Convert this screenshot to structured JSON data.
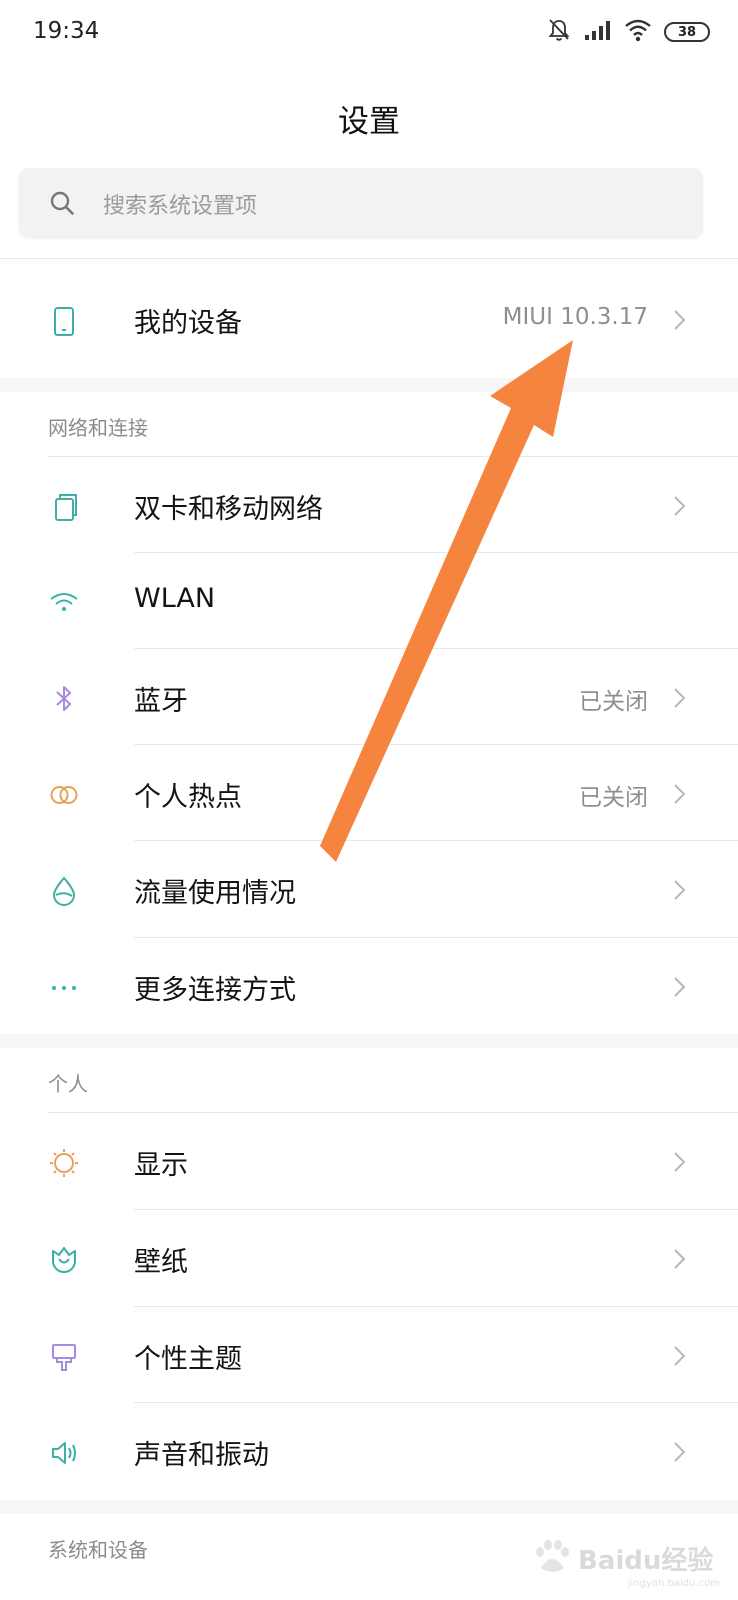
{
  "status_bar": {
    "time": "19:34",
    "battery": "38",
    "icons": [
      "bell-mute-icon",
      "signal-icon",
      "wifi-icon",
      "battery-icon"
    ]
  },
  "page": {
    "title": "设置"
  },
  "search": {
    "placeholder": "搜索系统设置项",
    "icon": "search-icon"
  },
  "my_device": {
    "label": "我的设备",
    "value": "MIUI 10.3.17",
    "icon": "phone-icon"
  },
  "sections": {
    "network": {
      "header": "网络和连接",
      "items": [
        {
          "label": "双卡和移动网络",
          "value": "",
          "icon": "dual-sim-icon"
        },
        {
          "label": "WLAN",
          "value": "",
          "icon": "wifi-icon"
        },
        {
          "label": "蓝牙",
          "value": "已关闭",
          "icon": "bluetooth-icon"
        },
        {
          "label": "个人热点",
          "value": "已关闭",
          "icon": "hotspot-icon"
        },
        {
          "label": "流量使用情况",
          "value": "",
          "icon": "data-usage-icon"
        },
        {
          "label": "更多连接方式",
          "value": "",
          "icon": "more-icon"
        }
      ]
    },
    "personal": {
      "header": "个人",
      "items": [
        {
          "label": "显示",
          "value": "",
          "icon": "sun-icon"
        },
        {
          "label": "壁纸",
          "value": "",
          "icon": "tulip-icon"
        },
        {
          "label": "个性主题",
          "value": "",
          "icon": "brush-icon"
        },
        {
          "label": "声音和振动",
          "value": "",
          "icon": "speaker-icon"
        }
      ]
    },
    "system": {
      "header": "系统和设备"
    }
  },
  "annotation": {
    "arrow_color": "#f47a2f"
  },
  "watermark": {
    "text": "Baidu经验",
    "sub": "jingyan.baidu.com"
  },
  "colors": {
    "teal": "#3bb0a6",
    "purple": "#a58be0",
    "orange": "#e8a25a",
    "arrow": "#f47a2f"
  }
}
